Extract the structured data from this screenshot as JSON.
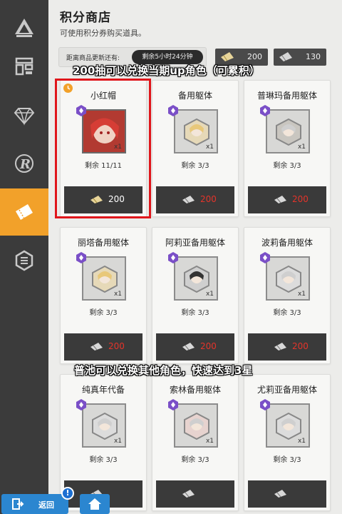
{
  "header": {
    "title": "积分商店",
    "subtitle": "可使用积分券购买道具。"
  },
  "timer": {
    "label": "距离商品更新还有:",
    "value": "剩余5小时24分钟"
  },
  "currency": [
    {
      "icon": "ticket-icon",
      "value": "200"
    },
    {
      "icon": "chip-icon",
      "value": "130"
    }
  ],
  "sidebar": {
    "items": [
      {
        "icon": "tower-icon",
        "active": false
      },
      {
        "icon": "building-icon",
        "active": false
      },
      {
        "icon": "diamond-icon",
        "active": false
      },
      {
        "icon": "r-logo-icon",
        "active": false
      },
      {
        "icon": "ticket-icon",
        "active": true
      },
      {
        "icon": "hex-badge-icon",
        "active": false
      }
    ]
  },
  "cards": [
    {
      "name": "小红帽",
      "stock": "剩余 11/11",
      "price": "200",
      "currency": "ticket-icon",
      "badge": "purple",
      "qty": "x1",
      "portrait": "red-hood"
    },
    {
      "name": "备用躯体",
      "stock": "剩余 3/3",
      "price": "200",
      "currency": "chip-icon",
      "badge": "purple",
      "qty": "x1",
      "portrait": "blonde"
    },
    {
      "name": "普琳玛备用躯体",
      "stock": "剩余 3/3",
      "price": "200",
      "currency": "chip-icon",
      "badge": "purple",
      "qty": "x1",
      "portrait": "grey"
    },
    {
      "name": "丽塔备用躯体",
      "stock": "剩余 3/3",
      "price": "200",
      "currency": "chip-icon",
      "badge": "purple",
      "qty": "x1",
      "portrait": "blonde"
    },
    {
      "name": "阿莉亚备用躯体",
      "stock": "剩余 3/3",
      "price": "200",
      "currency": "chip-icon",
      "badge": "purple",
      "qty": "x1",
      "portrait": "dark"
    },
    {
      "name": "波莉备用躯体",
      "stock": "剩余 3/3",
      "price": "200",
      "currency": "chip-icon",
      "badge": "purple",
      "qty": "x1",
      "portrait": "silver"
    },
    {
      "name": "纯真年代备",
      "stock": "剩余 3/3",
      "price": "",
      "currency": "chip-icon",
      "badge": "purple",
      "qty": "x1",
      "portrait": "silver"
    },
    {
      "name": "索林备用躯体",
      "stock": "剩余 3/3",
      "price": "",
      "currency": "chip-icon",
      "badge": "purple",
      "qty": "x1",
      "portrait": "pink"
    },
    {
      "name": "尤莉亚备用躯体",
      "stock": "剩余 3/3",
      "price": "",
      "currency": "chip-icon",
      "badge": "purple",
      "qty": "x1",
      "portrait": "silver"
    }
  ],
  "annotations": [
    "200抽可以兑换当期up角色（可累积）",
    "普池可以兑换其他角色，快速达到3星"
  ],
  "bottom": {
    "back_label": "返回",
    "info": "!"
  },
  "colors": {
    "accent": "#f2a12a",
    "price": "#e4342a",
    "highlight": "#e0161b",
    "button": "#2b86d0",
    "badge": "#7a4fc7"
  }
}
